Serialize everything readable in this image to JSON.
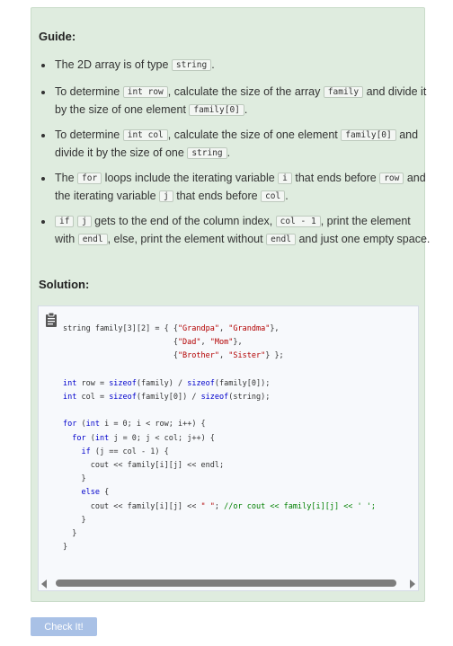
{
  "guide": {
    "heading": "Guide:",
    "bullets": [
      {
        "t1": "The 2D array is of type ",
        "c1": "string",
        "t2": "."
      },
      {
        "t1": "To determine ",
        "c1": "int row",
        "t2": ", calculate the size of the array ",
        "c2": "family",
        "t3": " and divide it by the size of one element ",
        "c3": "family[0]",
        "t4": "."
      },
      {
        "t1": "To determine ",
        "c1": "int col",
        "t2": ", calculate the size of one element ",
        "c2": "family[0]",
        "t3": " and divide it by the size of one ",
        "c3": "string",
        "t4": "."
      },
      {
        "t1": "The ",
        "c1": "for",
        "t2": " loops include the iterating variable ",
        "c2": "i",
        "t3": " that ends before ",
        "c3": "row",
        "t4": " and the iterating variable ",
        "c4": "j",
        "t5": " that ends before ",
        "c5": "col",
        "t6": "."
      },
      {
        "c1": "if",
        "t1": " ",
        "c2": "j",
        "t2": " gets to the end of the column index, ",
        "c3": "col - 1",
        "t3": ", print the element with ",
        "c4": "endl",
        "t4": ", else, print the element without ",
        "c5": "endl",
        "t5": " and just one empty space."
      }
    ]
  },
  "solution": {
    "heading": "Solution:",
    "clipboard_icon": "clipboard-icon"
  },
  "buttons": {
    "check": "Check It!"
  }
}
